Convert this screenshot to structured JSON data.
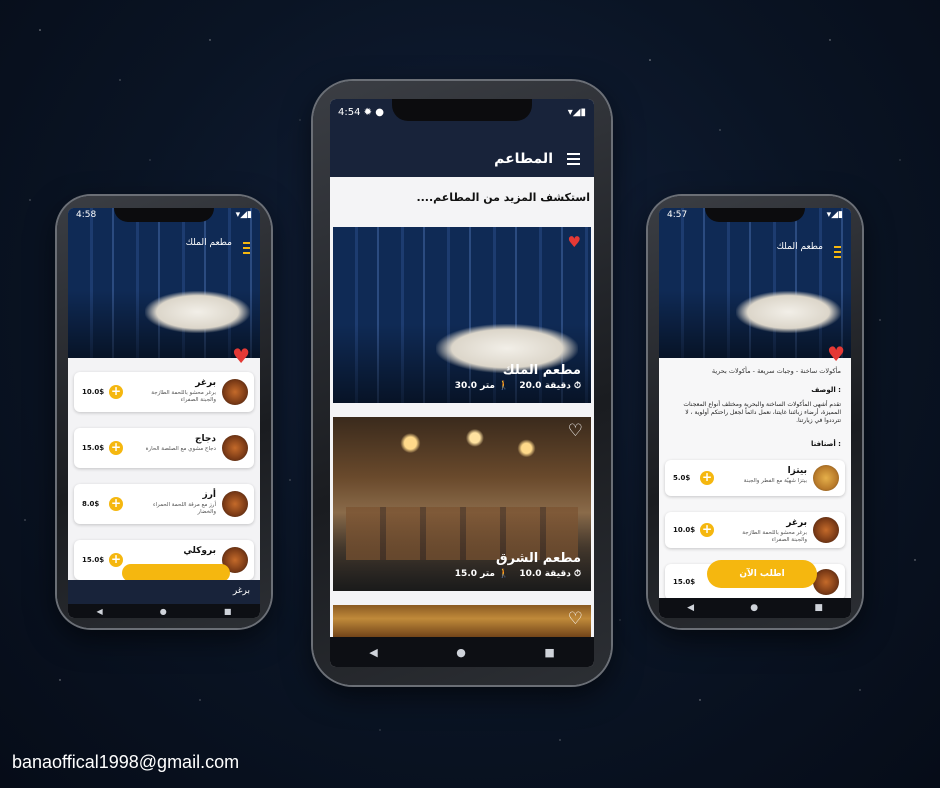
{
  "center": {
    "status_time": "4:54",
    "title": "المطاعم",
    "subtitle": "استكشف المزيد من المطاعم....",
    "cards": [
      {
        "name": "مطعم الملك",
        "time": "20.0 دقيقة",
        "distance": "30.0 متر",
        "favorite": true
      },
      {
        "name": "مطعم الشرق",
        "time": "10.0 دقيقة",
        "distance": "15.0 متر",
        "favorite": false
      },
      {
        "name": "",
        "time": "",
        "distance": "",
        "favorite": false
      }
    ]
  },
  "left": {
    "status_time": "4:58",
    "title": "مطعم الملك",
    "items": [
      {
        "name": "برغر",
        "desc": "برغر محشو باللحمة الطازجة والجبنة الصفراء",
        "price": "10.0$"
      },
      {
        "name": "دجاج",
        "desc": "دجاج مشوي مع الصلصة الحارة",
        "price": "15.0$"
      },
      {
        "name": "أرز",
        "desc": "أرز مع مرقة اللحمة الحمراء والخضار",
        "price": "8.0$"
      },
      {
        "name": "بروكلي",
        "desc": "",
        "price": "15.0$"
      }
    ],
    "bottom_label": "برغر"
  },
  "right": {
    "status_time": "4:57",
    "title": "مطعم الملك",
    "categories": "مأكولات ساخنة - وجبات سريعة - مأكولات بحرية",
    "desc_heading": "الوصف :",
    "description": "تقدم أشهى المأكولات الساخنة والبحرية ومختلف أنواع المعجنات المميزة، أرضاء زبائننا غايتنا، نعمل دائماً لجعل راحتكم أولوية ، لا تترددوا في زيارتنا.",
    "items_heading": "أصنافنا :",
    "items": [
      {
        "name": "بيتزا",
        "desc": "بيتزا شهيّة مع الفطر والجبنة",
        "price": "5.0$"
      },
      {
        "name": "برغر",
        "desc": "برغر محشو باللحمة الطازجة والجبنة الصفراء",
        "price": "10.0$"
      },
      {
        "name": "",
        "desc": "",
        "price": "15.0$"
      }
    ],
    "order_button": "اطلب الآن"
  },
  "footer": {
    "email": "banaoffical1998@gmail.com"
  },
  "colors": {
    "appbar": "#18233a",
    "accent": "#f5b70f",
    "heart": "#e53935"
  }
}
